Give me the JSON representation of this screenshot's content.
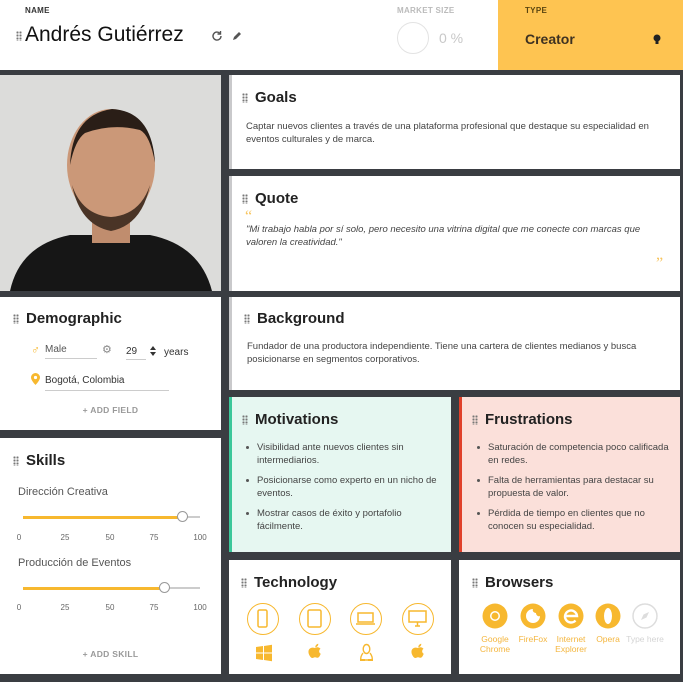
{
  "header": {
    "name_label": "NAME",
    "name": "Andrés Gutiérrez",
    "market_label": "MARKET SIZE",
    "market_value": "0 %",
    "type_label": "TYPE",
    "type_value": "Creator"
  },
  "goals": {
    "title": "Goals",
    "text": "Captar nuevos clientes a través de una plataforma profesional que destaque su especialidad en eventos culturales y de marca."
  },
  "quote": {
    "title": "Quote",
    "text": "\"Mi trabajo habla por sí solo, pero necesito una vitrina digital que me conecte con marcas que valoren la creatividad.\""
  },
  "demographic": {
    "title": "Demographic",
    "gender": "Male",
    "age": "29",
    "age_unit": "years",
    "location": "Bogotá, Colombia",
    "add_field": "+ ADD FIELD"
  },
  "background": {
    "title": "Background",
    "text": "Fundador de una productora independiente. Tiene una cartera de clientes medianos y busca posicionarse en segmentos corporativos."
  },
  "skills": {
    "title": "Skills",
    "items": [
      {
        "name": "Dirección Creativa",
        "value": 90
      },
      {
        "name": "Producción de Eventos",
        "value": 80
      }
    ],
    "ticks": [
      "0",
      "25",
      "50",
      "75",
      "100"
    ],
    "add_skill": "+ ADD SKILL"
  },
  "motivations": {
    "title": "Motivations",
    "items": [
      "Visibilidad ante nuevos clientes sin intermediarios.",
      "Posicionarse como experto en un nicho de eventos.",
      "Mostrar casos de éxito y portafolio fácilmente."
    ]
  },
  "frustrations": {
    "title": "Frustrations",
    "items": [
      "Saturación de competencia poco calificada en redes.",
      "Falta de herramientas para destacar su propuesta de valor.",
      "Pérdida de tiempo en clientes que no conocen su especialidad."
    ]
  },
  "technology": {
    "title": "Technology",
    "devices": [
      "mobile-icon",
      "tablet-icon",
      "laptop-icon",
      "desktop-icon"
    ],
    "os": [
      "windows-icon",
      "apple-icon",
      "linux-icon",
      "apple-icon"
    ]
  },
  "browsers": {
    "title": "Browsers",
    "items": [
      {
        "label": "Google Chrome",
        "icon": "chrome-icon",
        "active": true
      },
      {
        "label": "FireFox",
        "icon": "firefox-icon",
        "active": true
      },
      {
        "label": "Internet Explorer",
        "icon": "ie-icon",
        "active": true
      },
      {
        "label": "Opera",
        "icon": "opera-icon",
        "active": true
      },
      {
        "label": "Type here",
        "icon": "compass-icon",
        "active": false
      }
    ]
  },
  "colors": {
    "accent": "#f7b82f",
    "type_bg": "#fec451",
    "motivations_bg": "#e6f7f1",
    "motivations_bar": "#3cc79a",
    "frustrations_bg": "#fbe0da",
    "frustrations_bar": "#e0412b"
  }
}
